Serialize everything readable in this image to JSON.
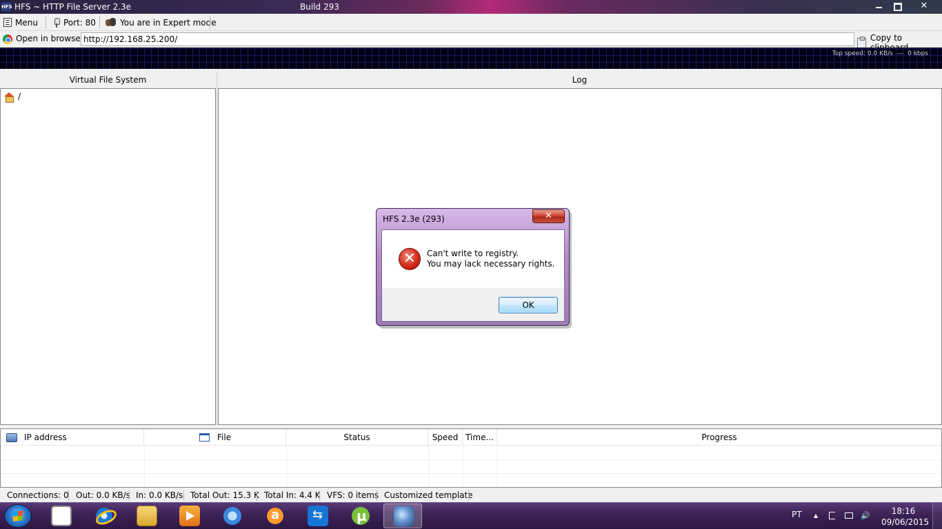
{
  "window": {
    "title": "HFS ~ HTTP File Server 2.3e",
    "build": "Build 293",
    "icon_label": "HFS"
  },
  "toolbar": {
    "menu_label": "Menu",
    "port_label": "Port: 80",
    "mode_label": "You are in Expert mode"
  },
  "urlbar": {
    "open_browser_label": "Open in browser",
    "url": "http://192.168.25.200/",
    "copy_label": "Copy to clipboard"
  },
  "graph": {
    "top_speed": "Top speed: 0.0 KB/s",
    "separator": "---",
    "kbps": "0 kbps"
  },
  "panels": {
    "vfs_title": "Virtual File System",
    "vfs_root": "/",
    "log_title": "Log"
  },
  "connections": {
    "columns": [
      "IP address",
      "File",
      "Status",
      "Speed",
      "Time...",
      "Progress"
    ]
  },
  "statusbar": {
    "connections": "Connections: 0",
    "out": "Out: 0.0 KB/s",
    "in": "In: 0.0 KB/s",
    "total_out": "Total Out: 15.3 K",
    "total_in": "Total In: 4.4 K",
    "vfs_items": "VFS: 0 items",
    "template": "Customized template"
  },
  "dialog": {
    "title": "HFS 2.3e (293)",
    "close_glyph": "✕",
    "error_glyph": "✕",
    "message_line1": "Can't write to registry.",
    "message_line2": "You may lack necessary rights.",
    "ok_label": "OK"
  },
  "taskbar": {
    "apps": [
      "notepad-icon",
      "internet-explorer-icon",
      "file-explorer-icon",
      "media-player-icon",
      "network-tool-icon",
      "avast-icon",
      "teamviewer-icon",
      "utorrent-icon",
      "hfs-icon"
    ],
    "language": "PT",
    "tray_up_glyph": "▲",
    "tray_volume_glyph": "🔊",
    "time": "18:16",
    "date": "09/06/2015"
  }
}
